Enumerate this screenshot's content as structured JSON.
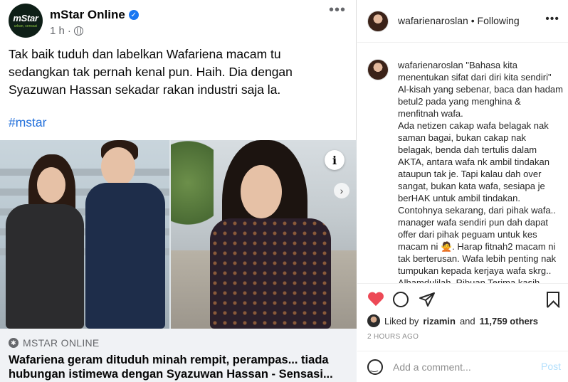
{
  "facebook": {
    "page_name": "mStar Online",
    "avatar_logo_main": "mStar",
    "avatar_logo_tagline": "urban, sensasi",
    "time": "1 h",
    "separator": "·",
    "more": "•••",
    "post_text": "Tak baik tuduh dan labelkan Wafariena macam tu sedangkan tak pernah kenal pun. Haih. Dia dengan Syazuwan Hassan sekadar rakan industri saja la.",
    "hashtag": "#mstar",
    "info_glyph": "i",
    "next_glyph": "›",
    "link": {
      "domain": "MSTAR ONLINE",
      "title": "Wafariena geram dituduh minah rempit, perampas... tiada hubungan istimewa dengan Syazuwan Hassan - Sensasi..."
    }
  },
  "instagram": {
    "username": "wafarienaroslan",
    "follow_status": "Following",
    "separator": "•",
    "more": "•••",
    "caption_user": "wafarienaroslan",
    "caption_text": " \"Bahasa kita menentukan sifat dari diri kita sendiri\"\nAl-kisah yang sebenar, baca dan hadam betul2 pada yang menghina & menfitnah wafa.\nAda netizen cakap wafa belagak nak saman bagai, bukan cakap nak belagak, benda dah tertulis dalam AKTA, antara wafa nk ambil tindakan ataupun tak je. Tapi kalau dah over sangat, bukan kata wafa, sesiapa je berHAK untuk ambil tindakan.\nContohnya sekarang, dari pihak wafa.. manager wafa sendiri pun dah dapat offer dari pihak peguam untuk kes macam ni 🙅. Harap fitnah2 macam ni tak berterusan. Wafa lebih penting nak tumpukan kepada kerjaya wafa skrg.. Alhamdulilah, Ribuan Terima kasih kepada semua pihak yang telah",
    "likes_prefix": "Liked by",
    "liked_by": "rizamin",
    "likes_and": "and",
    "likes_count": "11,759 others",
    "timestamp": "2 HOURS AGO",
    "comment_placeholder": "Add a comment...",
    "post_label": "Post"
  },
  "colors": {
    "fb_blue": "#1877f2",
    "hashtag_blue": "#216fdb",
    "ig_like_red": "#ed4956",
    "ig_post_disabled": "#b2dffc"
  }
}
